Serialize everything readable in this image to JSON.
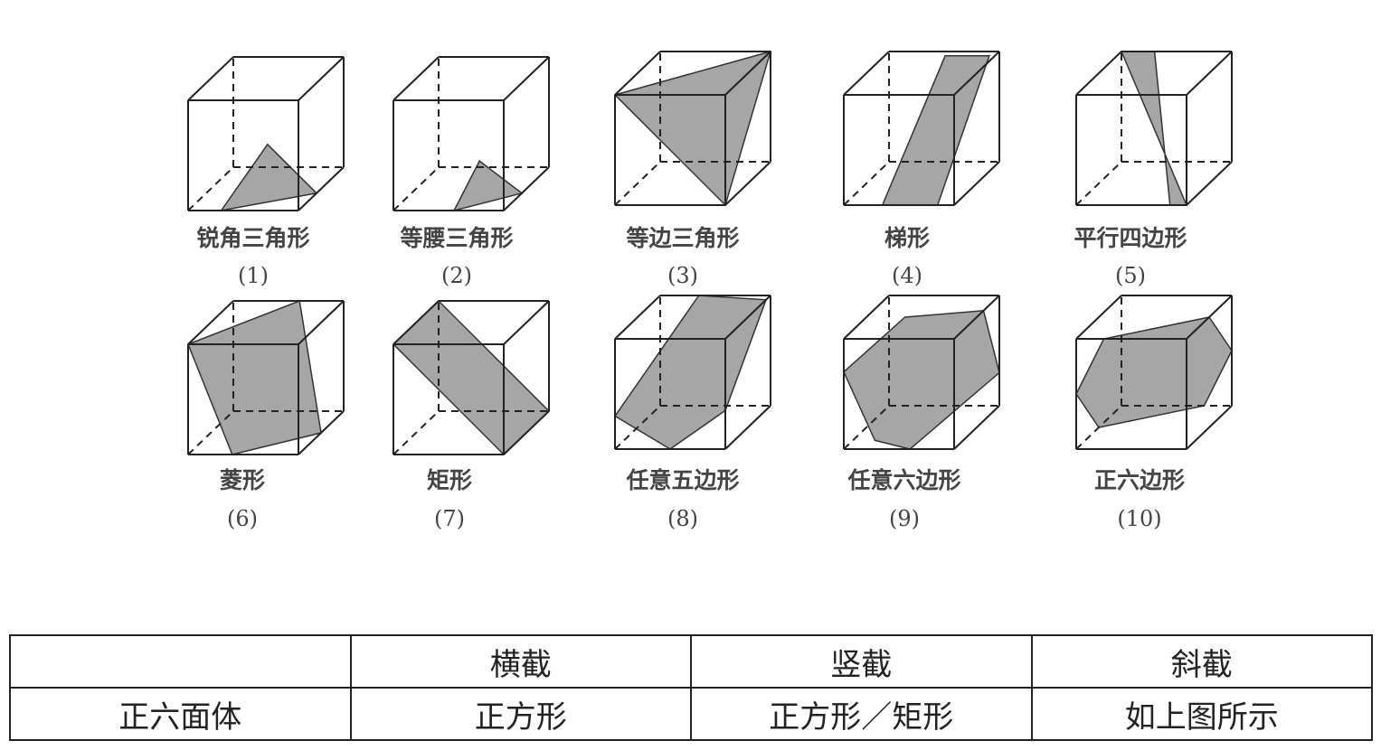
{
  "figure": {
    "cubes": [
      {
        "label": "锐角三角形",
        "number": "(1)"
      },
      {
        "label": "等腰三角形",
        "number": "(2)"
      },
      {
        "label": "等边三角形",
        "number": "(3)"
      },
      {
        "label": "梯形",
        "number": "(4)"
      },
      {
        "label": "平行四边形",
        "number": "(5)"
      },
      {
        "label": "菱形",
        "number": "(6)"
      },
      {
        "label": "矩形",
        "number": "(7)"
      },
      {
        "label": "任意五边形",
        "number": "(8)"
      },
      {
        "label": "任意六边形",
        "number": "(9)"
      },
      {
        "label": "正六边形",
        "number": "(10)"
      }
    ]
  },
  "table": {
    "header": [
      "",
      "横截",
      "竖截",
      "斜截"
    ],
    "row": [
      "正六面体",
      "正方形",
      "正方形／矩形",
      "如上图所示"
    ]
  }
}
